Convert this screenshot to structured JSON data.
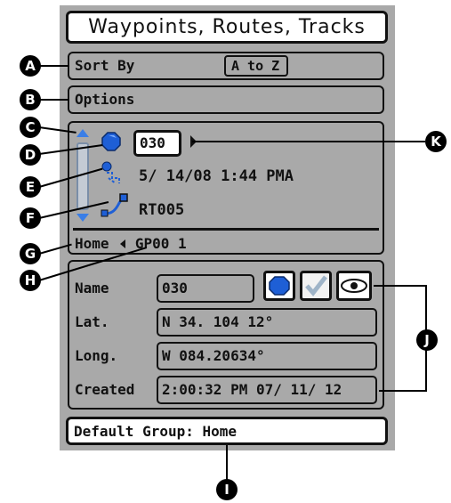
{
  "title": "Waypoints, Routes, Tracks",
  "sort": {
    "label": "Sort By",
    "value": "A to Z"
  },
  "options": {
    "label": "Options"
  },
  "list": {
    "waypoint_name": "030",
    "group_item": "5/ 14/08 1:44 PMA",
    "route_item": "RT005"
  },
  "path": {
    "group": "Home",
    "item": "GP00 1"
  },
  "details": {
    "name_label": "Name",
    "name_value": "030",
    "lat_label": "Lat.",
    "lat_value": "N 34. 104 12°",
    "long_label": "Long.",
    "long_value": "W 084.20634°",
    "created_label": "Created",
    "created_value": "2:00:32 PM 07/ 11/ 12"
  },
  "footer": {
    "text": "Default Group: Home"
  },
  "callouts": [
    "A",
    "B",
    "C",
    "D",
    "E",
    "F",
    "G",
    "H",
    "I",
    "J",
    "K"
  ],
  "colors": {
    "panel": "#a9a9a9",
    "waypoint_blue": "#1e5fd6",
    "border": "#111111"
  }
}
